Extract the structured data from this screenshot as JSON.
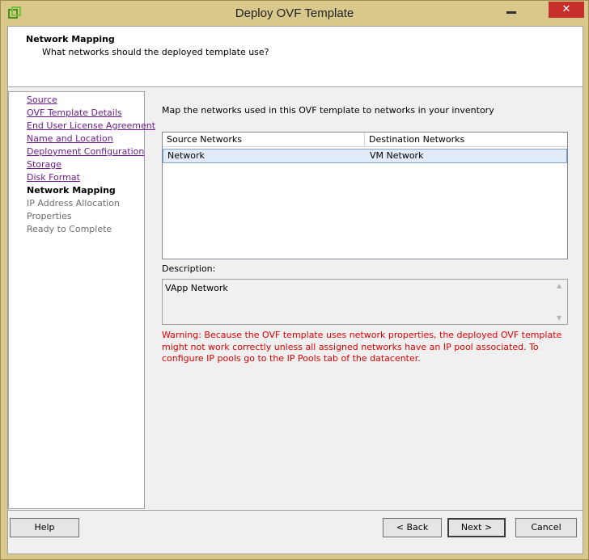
{
  "window": {
    "title": "Deploy OVF Template",
    "close_glyph": "✕"
  },
  "header": {
    "title": "Network Mapping",
    "subtitle": "What networks should the deployed template use?"
  },
  "steps": [
    {
      "label": "Source",
      "state": "link"
    },
    {
      "label": "OVF Template Details",
      "state": "link"
    },
    {
      "label": "End User License Agreement",
      "state": "link"
    },
    {
      "label": "Name and Location",
      "state": "link"
    },
    {
      "label": "Deployment Configuration",
      "state": "link"
    },
    {
      "label": "Storage",
      "state": "link"
    },
    {
      "label": "Disk Format",
      "state": "link"
    },
    {
      "label": "Network Mapping",
      "state": "current"
    },
    {
      "label": "IP Address Allocation",
      "state": "pending"
    },
    {
      "label": "Properties",
      "state": "pending"
    },
    {
      "label": "Ready to Complete",
      "state": "pending"
    }
  ],
  "main": {
    "instruction": "Map the networks used in this OVF template to networks in your inventory",
    "table": {
      "columns": [
        "Source Networks",
        "Destination Networks"
      ],
      "rows": [
        {
          "source": "Network",
          "destination": "VM Network"
        }
      ]
    },
    "description_label": "Description:",
    "description_value": "VApp Network",
    "warning": "Warning: Because the OVF template uses network properties, the deployed OVF template might not work correctly unless all assigned networks have an IP pool associated. To configure IP pools go to the IP Pools tab of the datacenter."
  },
  "footer": {
    "help_label": "Help",
    "back_label": "< Back",
    "next_label": "Next >",
    "cancel_label": "Cancel"
  },
  "colors": {
    "frame": "#d8c88c",
    "link": "#6e1c94",
    "warning": "#e00000",
    "selection": "#e1ecf8",
    "close": "#c7302a"
  }
}
